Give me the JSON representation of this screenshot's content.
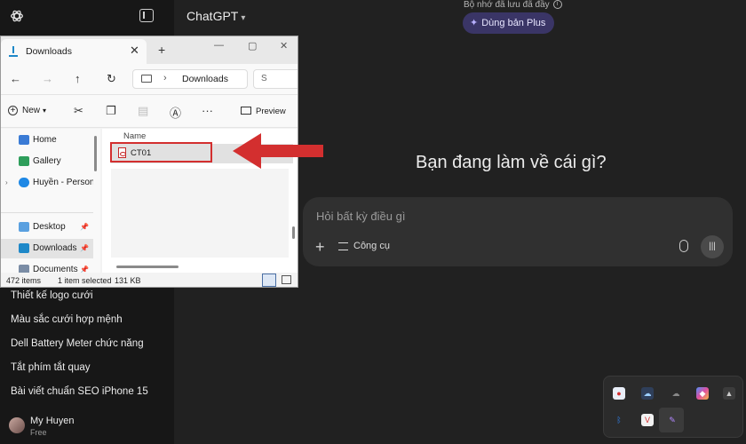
{
  "chatgpt": {
    "app_title": "ChatGPT",
    "memory_note": "Bộ nhớ đã lưu đã đầy",
    "plus_button": "Dùng bản Plus",
    "headline": "Bạn đang làm về cái gì?",
    "composer_placeholder": "Hỏi bất kỳ điều gì",
    "tools_label": "Công cụ",
    "chats": [
      "Thiết kế logo cưới",
      "Màu sắc cưới hợp mệnh",
      "Dell Battery Meter chức năng",
      "Tắt phím tắt quay",
      "Bài viết chuẩn SEO iPhone 15"
    ],
    "user": {
      "name": "My Huyen",
      "plan": "Free"
    }
  },
  "explorer": {
    "tab_title": "Downloads",
    "address": "Downloads",
    "search_hint": "S",
    "toolbar": {
      "new_label": "New",
      "preview_label": "Preview"
    },
    "nav_items": [
      {
        "label": "Home",
        "color": "#3a7bd5"
      },
      {
        "label": "Gallery",
        "color": "#2e9e5b"
      },
      {
        "label": "Huyền - Personal",
        "color": "#1e88e5"
      },
      {
        "label": "Desktop",
        "color": "#5aa0e0"
      },
      {
        "label": "Downloads",
        "color": "#1e88c8"
      },
      {
        "label": "Documents",
        "color": "#7a8ca5"
      }
    ],
    "column_header": "Name",
    "file_name": "CT01",
    "status": {
      "count": "472 items",
      "selected": "1 item selected",
      "size": "131 KB"
    }
  },
  "colors": {
    "accent_red": "#d32f2f",
    "plus_bg": "#3a3566"
  }
}
